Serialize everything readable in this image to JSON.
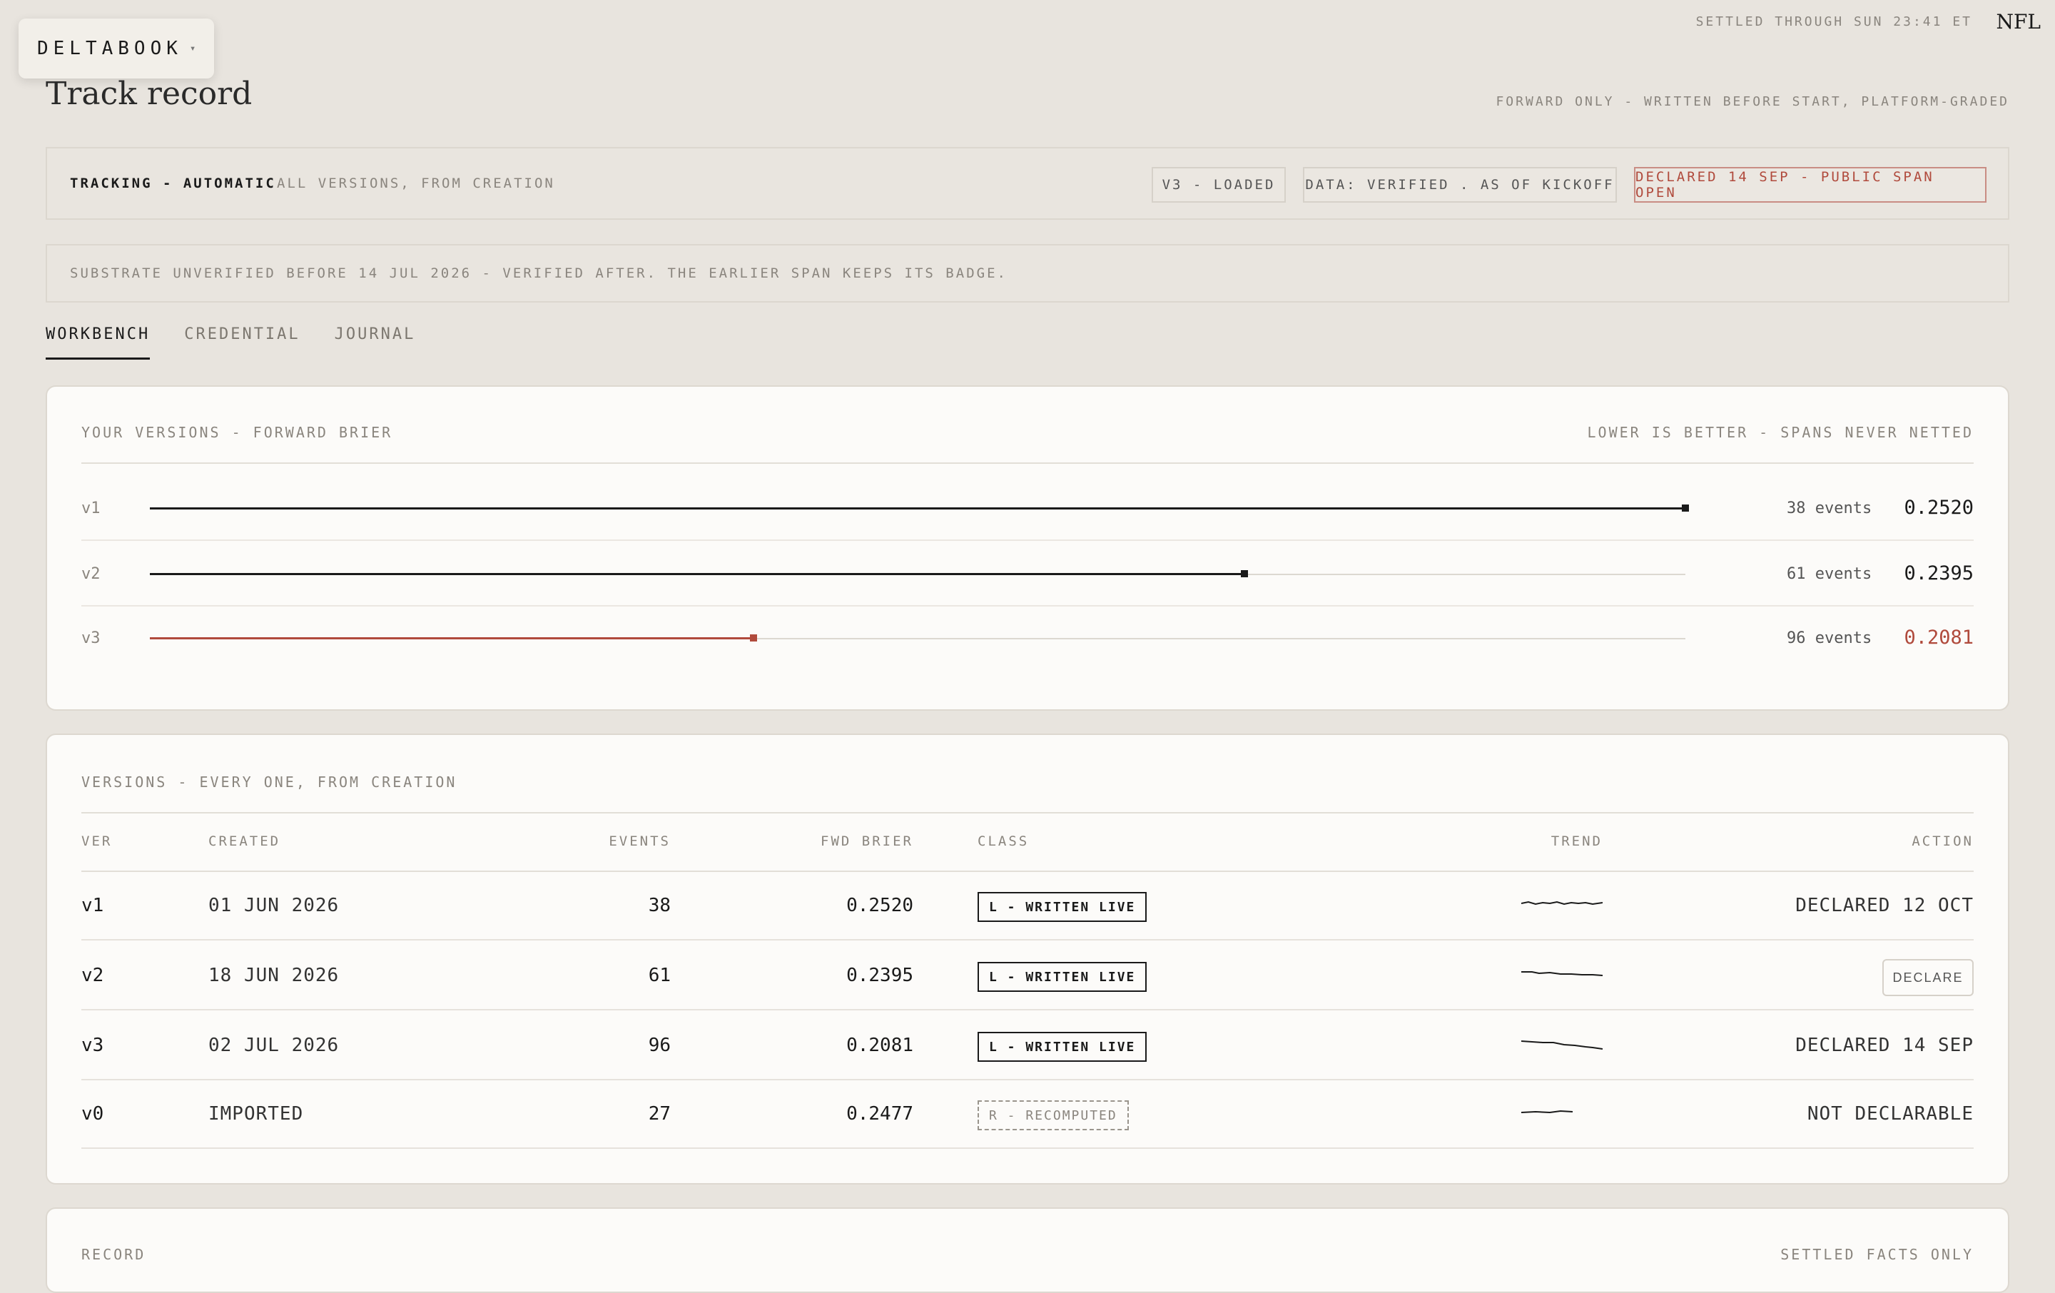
{
  "brand": {
    "name": "DELTABOOK",
    "caret": "▾"
  },
  "header": {
    "settled": "SETTLED THROUGH SUN 23:41 ET",
    "league": "NFL",
    "title": "Track record",
    "forward_note": "FORWARD ONLY - WRITTEN BEFORE START, PLATFORM-GRADED"
  },
  "tracking": {
    "label": "TRACKING - AUTOMATIC",
    "sub": "ALL VERSIONS, FROM CREATION",
    "chips": {
      "loaded": "V3 - LOADED",
      "data": "DATA: VERIFIED . AS OF KICKOFF",
      "declared": "DECLARED 14 SEP - PUBLIC SPAN OPEN"
    }
  },
  "substrate": "SUBSTRATE UNVERIFIED BEFORE 14 JUL 2026 - VERIFIED AFTER. THE EARLIER SPAN KEEPS ITS BADGE.",
  "tabs": [
    "WORKBENCH",
    "CREDENTIAL",
    "JOURNAL"
  ],
  "versions_card": {
    "title": "YOUR VERSIONS - FORWARD BRIER",
    "note": "LOWER IS BETTER - SPANS NEVER NETTED",
    "rows": [
      {
        "name": "v1",
        "events": "38 events",
        "score": "0.2520",
        "fill": 1.0,
        "color": "#1a1a1a"
      },
      {
        "name": "v2",
        "events": "61 events",
        "score": "0.2395",
        "fill": 0.713,
        "color": "#1a1a1a"
      },
      {
        "name": "v3",
        "events": "96 events",
        "score": "0.2081",
        "fill": 0.393,
        "color": "#b04a3c"
      }
    ]
  },
  "table_card": {
    "title": "VERSIONS - EVERY ONE, FROM CREATION",
    "headers": {
      "ver": "VER",
      "created": "CREATED",
      "events": "EVENTS",
      "brier": "FWD BRIER",
      "class": "CLASS",
      "trend": "TREND",
      "action": "ACTION"
    },
    "rows": [
      {
        "ver": "v1",
        "created": "01 JUN 2026",
        "events": "38",
        "brier": "0.2520",
        "class": "L - WRITTEN LIVE",
        "action": "DECLARED 12 OCT"
      },
      {
        "ver": "v2",
        "created": "18 JUN 2026",
        "events": "61",
        "brier": "0.2395",
        "class": "L - WRITTEN LIVE",
        "action": "DECLARE"
      },
      {
        "ver": "v3",
        "created": "02 JUL 2026",
        "events": "96",
        "brier": "0.2081",
        "class": "L - WRITTEN LIVE",
        "action": "DECLARED 14 SEP"
      },
      {
        "ver": "v0",
        "created": "IMPORTED",
        "events": "27",
        "brier": "0.2477",
        "class": "R - RECOMPUTED",
        "action": "NOT DECLARABLE"
      }
    ]
  },
  "record_card": {
    "title": "RECORD",
    "note": "SETTLED FACTS ONLY"
  }
}
